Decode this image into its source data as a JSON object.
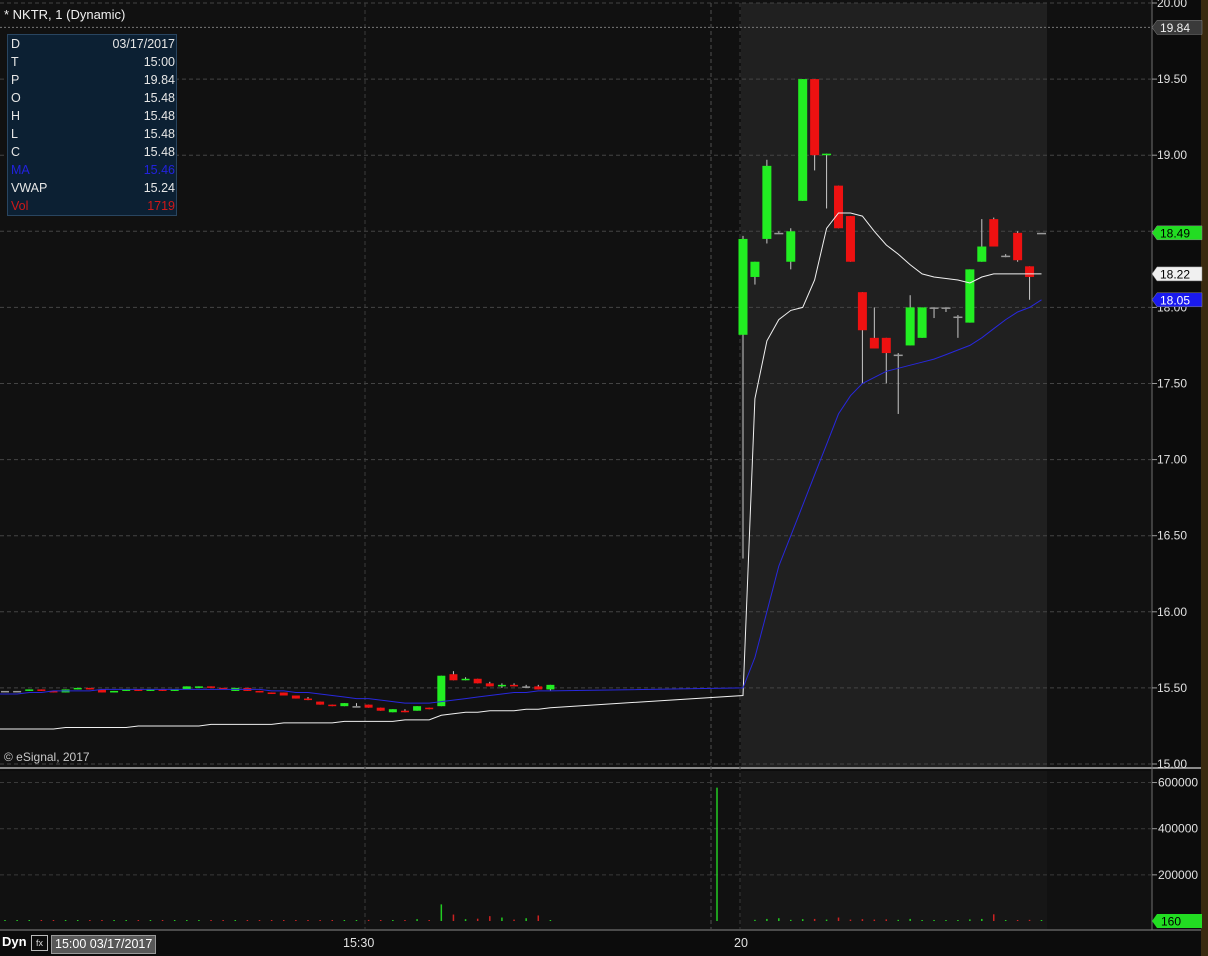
{
  "window": {
    "title": "* NKTR, 1 (Dynamic)"
  },
  "info_panel": [
    {
      "label": "D",
      "value": "03/17/2017",
      "color": "#e6e6e6"
    },
    {
      "label": "T",
      "value": "15:00",
      "color": "#e6e6e6"
    },
    {
      "label": "P",
      "value": "19.84",
      "color": "#e6e6e6"
    },
    {
      "label": "O",
      "value": "15.48",
      "color": "#e6e6e6"
    },
    {
      "label": "H",
      "value": "15.48",
      "color": "#e6e6e6"
    },
    {
      "label": "L",
      "value": "15.48",
      "color": "#e6e6e6"
    },
    {
      "label": "C",
      "value": "15.48",
      "color": "#e6e6e6"
    },
    {
      "label": "MA",
      "value": "15.46",
      "color": "#2222dd"
    },
    {
      "label": "VWAP",
      "value": "15.24",
      "color": "#e6e6e6"
    },
    {
      "label": "Vol",
      "value": "1719",
      "color": "#d01818"
    }
  ],
  "copyright": "© eSignal, 2017",
  "footer": {
    "mode": "Dyn",
    "icon": "fx-icon",
    "time_label": "15:00 03/17/2017",
    "x_ticks": [
      "15:30",
      "20"
    ]
  },
  "colors": {
    "up": "#22ee22",
    "down": "#ee1111",
    "ma": "#2828dd",
    "vwap": "#f0f0f0",
    "volume_up": "#22cc22",
    "volume_down": "#cc2222"
  },
  "chart_data": {
    "type": "candlestick",
    "price_axis": {
      "ticks": [
        "20.00",
        "19.50",
        "19.00",
        "18.50",
        "18.00",
        "17.50",
        "17.00",
        "16.50",
        "16.00",
        "15.50",
        "15.00"
      ],
      "range": [
        15.0,
        20.0
      ]
    },
    "volume_axis": {
      "ticks": [
        "600000",
        "400000",
        "200000"
      ],
      "range": [
        0,
        650000
      ]
    },
    "markers": [
      {
        "label": "19.84",
        "value": 19.84,
        "style": "grey"
      },
      {
        "label": "18.49",
        "value": 18.49,
        "style": "green"
      },
      {
        "label": "18.22",
        "value": 18.22,
        "style": "white"
      },
      {
        "label": "18.05",
        "value": 18.05,
        "style": "blue"
      }
    ],
    "volume_marker": {
      "label": "160",
      "value": 160
    },
    "candles": [
      [
        15.48,
        15.48,
        15.48,
        15.48
      ],
      [
        15.48,
        15.48,
        15.48,
        15.48
      ],
      [
        15.48,
        15.49,
        15.48,
        15.49
      ],
      [
        15.49,
        15.49,
        15.48,
        15.48
      ],
      [
        15.48,
        15.48,
        15.47,
        15.47
      ],
      [
        15.47,
        15.49,
        15.47,
        15.49
      ],
      [
        15.49,
        15.5,
        15.49,
        15.5
      ],
      [
        15.5,
        15.5,
        15.49,
        15.49
      ],
      [
        15.49,
        15.49,
        15.47,
        15.47
      ],
      [
        15.47,
        15.48,
        15.47,
        15.48
      ],
      [
        15.48,
        15.49,
        15.48,
        15.49
      ],
      [
        15.49,
        15.49,
        15.48,
        15.48
      ],
      [
        15.48,
        15.49,
        15.48,
        15.49
      ],
      [
        15.49,
        15.49,
        15.48,
        15.48
      ],
      [
        15.48,
        15.49,
        15.48,
        15.49
      ],
      [
        15.49,
        15.51,
        15.49,
        15.51
      ],
      [
        15.5,
        15.51,
        15.5,
        15.51
      ],
      [
        15.51,
        15.51,
        15.5,
        15.5
      ],
      [
        15.5,
        15.5,
        15.49,
        15.49
      ],
      [
        15.48,
        15.5,
        15.48,
        15.5
      ],
      [
        15.5,
        15.5,
        15.48,
        15.48
      ],
      [
        15.48,
        15.48,
        15.47,
        15.47
      ],
      [
        15.47,
        15.47,
        15.46,
        15.46
      ],
      [
        15.47,
        15.47,
        15.45,
        15.45
      ],
      [
        15.45,
        15.45,
        15.43,
        15.43
      ],
      [
        15.43,
        15.44,
        15.42,
        15.42
      ],
      [
        15.41,
        15.41,
        15.39,
        15.39
      ],
      [
        15.39,
        15.39,
        15.38,
        15.38
      ],
      [
        15.38,
        15.4,
        15.38,
        15.4
      ],
      [
        15.38,
        15.4,
        15.38,
        15.38
      ],
      [
        15.39,
        15.39,
        15.37,
        15.37
      ],
      [
        15.37,
        15.37,
        15.35,
        15.35
      ],
      [
        15.34,
        15.36,
        15.34,
        15.36
      ],
      [
        15.35,
        15.36,
        15.34,
        15.34
      ],
      [
        15.35,
        15.38,
        15.35,
        15.38
      ],
      [
        15.37,
        15.37,
        15.36,
        15.36
      ],
      [
        15.38,
        15.58,
        15.38,
        15.58
      ],
      [
        15.59,
        15.61,
        15.55,
        15.55
      ],
      [
        15.55,
        15.57,
        15.55,
        15.56
      ],
      [
        15.56,
        15.56,
        15.53,
        15.53
      ],
      [
        15.53,
        15.54,
        15.51,
        15.51
      ],
      [
        15.51,
        15.53,
        15.5,
        15.52
      ],
      [
        15.52,
        15.53,
        15.51,
        15.51
      ],
      [
        15.51,
        15.52,
        15.5,
        15.51
      ],
      [
        15.51,
        15.52,
        15.49,
        15.49
      ],
      [
        15.49,
        15.52,
        15.48,
        15.52
      ],
      [
        17.82,
        18.47,
        16.35,
        18.45
      ],
      [
        18.2,
        18.3,
        18.15,
        18.3
      ],
      [
        18.45,
        18.97,
        18.42,
        18.93
      ],
      [
        18.49,
        18.5,
        18.49,
        18.49
      ],
      [
        18.3,
        18.52,
        18.25,
        18.5
      ],
      [
        18.7,
        19.5,
        18.7,
        19.5
      ],
      [
        19.5,
        19.5,
        18.9,
        19.0
      ],
      [
        19.0,
        19.01,
        18.65,
        19.01
      ],
      [
        18.8,
        18.8,
        18.52,
        18.52
      ],
      [
        18.6,
        18.6,
        18.3,
        18.3
      ],
      [
        18.1,
        18.1,
        17.5,
        17.85
      ],
      [
        17.8,
        18.0,
        17.73,
        17.73
      ],
      [
        17.8,
        17.8,
        17.5,
        17.7
      ],
      [
        17.69,
        17.7,
        17.3,
        17.69
      ],
      [
        17.75,
        18.08,
        17.75,
        18.0
      ],
      [
        17.8,
        18.0,
        17.8,
        18.0
      ],
      [
        18.0,
        18.0,
        17.93,
        18.0
      ],
      [
        18.0,
        18.0,
        17.97,
        18.0
      ],
      [
        17.94,
        17.95,
        17.8,
        17.94
      ],
      [
        17.9,
        18.25,
        17.9,
        18.25
      ],
      [
        18.3,
        18.58,
        18.3,
        18.4
      ],
      [
        18.58,
        18.59,
        18.4,
        18.4
      ],
      [
        18.34,
        18.35,
        18.33,
        18.34
      ],
      [
        18.49,
        18.5,
        18.3,
        18.31
      ],
      [
        18.27,
        18.27,
        18.05,
        18.2
      ],
      [
        18.49,
        18.49,
        18.49,
        18.49
      ]
    ],
    "vwap": [
      15.23,
      15.23,
      15.23,
      15.23,
      15.23,
      15.24,
      15.24,
      15.24,
      15.24,
      15.24,
      15.24,
      15.25,
      15.25,
      15.25,
      15.25,
      15.25,
      15.25,
      15.26,
      15.26,
      15.26,
      15.26,
      15.26,
      15.26,
      15.27,
      15.27,
      15.27,
      15.27,
      15.27,
      15.28,
      15.28,
      15.28,
      15.28,
      15.28,
      15.29,
      15.29,
      15.29,
      15.32,
      15.33,
      15.34,
      15.34,
      15.35,
      15.35,
      15.35,
      15.36,
      15.36,
      15.37,
      15.45,
      17.4,
      17.78,
      17.92,
      17.98,
      18.0,
      18.18,
      18.52,
      18.62,
      18.62,
      18.6,
      18.5,
      18.41,
      18.35,
      18.28,
      18.22,
      18.2,
      18.19,
      18.18,
      18.16,
      18.2,
      18.22,
      18.22,
      18.22,
      18.22,
      18.22
    ],
    "ma": [
      15.46,
      15.46,
      15.47,
      15.47,
      15.48,
      15.48,
      15.48,
      15.48,
      15.49,
      15.49,
      15.49,
      15.49,
      15.49,
      15.49,
      15.49,
      15.49,
      15.49,
      15.49,
      15.49,
      15.49,
      15.49,
      15.49,
      15.48,
      15.48,
      15.47,
      15.47,
      15.46,
      15.45,
      15.44,
      15.43,
      15.43,
      15.42,
      15.41,
      15.4,
      15.4,
      15.4,
      15.41,
      15.42,
      15.43,
      15.44,
      15.45,
      15.46,
      15.47,
      15.47,
      15.48,
      15.48,
      15.5,
      15.7,
      16.0,
      16.3,
      16.5,
      16.7,
      16.9,
      17.1,
      17.3,
      17.42,
      17.5,
      17.54,
      17.58,
      17.6,
      17.62,
      17.64,
      17.66,
      17.69,
      17.72,
      17.75,
      17.8,
      17.86,
      17.92,
      17.97,
      18.0,
      18.05
    ],
    "volume": [
      200,
      300,
      400,
      300,
      350,
      400,
      300,
      500,
      300,
      450,
      300,
      400,
      300,
      500,
      800,
      400,
      500,
      300,
      400,
      700,
      700,
      400,
      900,
      1300,
      1500,
      2500,
      1800,
      2000,
      1400,
      1500,
      4800,
      1900,
      2400,
      2600,
      8000,
      1800,
      72000,
      28000,
      7800,
      10000,
      21000,
      15000,
      6000,
      12000,
      24000,
      1719,
      578000,
      5000,
      9000,
      12000,
      5000,
      8000,
      9000,
      6000,
      15000,
      6000,
      8000,
      6000,
      7000,
      5000,
      9000,
      4000,
      4500,
      3500,
      4000,
      7000,
      9000,
      29000,
      4000,
      3000,
      5000,
      160
    ]
  }
}
